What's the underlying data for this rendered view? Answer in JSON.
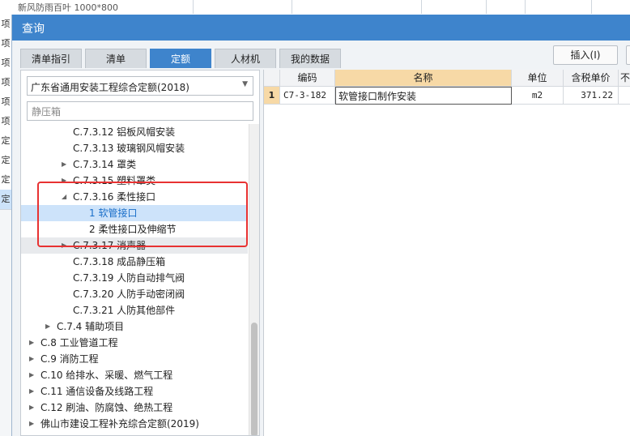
{
  "background": {
    "top_row_text": "新风防雨百叶 1000*800",
    "left_cells": [
      "项",
      "项",
      "项",
      "项",
      "项",
      "项",
      "定",
      "定",
      "定",
      "定"
    ]
  },
  "dialog": {
    "title": "查询",
    "tabs": [
      "清单指引",
      "清单",
      "定额",
      "人材机",
      "我的数据"
    ],
    "insert_button": "插入(I)"
  },
  "left": {
    "quota_library": "广东省通用安装工程综合定额(2018)",
    "search_value": "静压箱",
    "tree": [
      {
        "label": "C.7.3.12 铝板风帽安装"
      },
      {
        "label": "C.7.3.13 玻璃钢风帽安装"
      },
      {
        "label": "C.7.3.14 罩类"
      },
      {
        "label": "C.7.3.15 塑料罩类"
      },
      {
        "label": "C.7.3.16 柔性接口"
      },
      {
        "label": "1 软管接口"
      },
      {
        "label": "2 柔性接口及伸缩节"
      },
      {
        "label": "C.7.3.17 消声器"
      },
      {
        "label": "C.7.3.18 成品静压箱"
      },
      {
        "label": "C.7.3.19 人防自动排气阀"
      },
      {
        "label": "C.7.3.20 人防手动密闭阀"
      },
      {
        "label": "C.7.3.21 人防其他部件"
      },
      {
        "label": "C.7.4 辅助项目"
      },
      {
        "label": "C.8 工业管道工程"
      },
      {
        "label": "C.9 消防工程"
      },
      {
        "label": "C.10 给排水、采暖、燃气工程"
      },
      {
        "label": "C.11 通信设备及线路工程"
      },
      {
        "label": "C.12 刷油、防腐蚀、绝热工程"
      },
      {
        "label": "佛山市建设工程补充综合定额(2019)"
      }
    ]
  },
  "grid": {
    "headers": [
      "编码",
      "名称",
      "单位",
      "含税单价",
      "不"
    ],
    "rows": [
      {
        "index": "1",
        "code": "C7-3-182",
        "name": "软管接口制作安装",
        "unit": "m2",
        "price": "371.22"
      }
    ]
  },
  "icons": {
    "expanded": "caret-down-icon",
    "collapsed": "caret-right-icon",
    "dropdown": "chevron-down-icon"
  }
}
